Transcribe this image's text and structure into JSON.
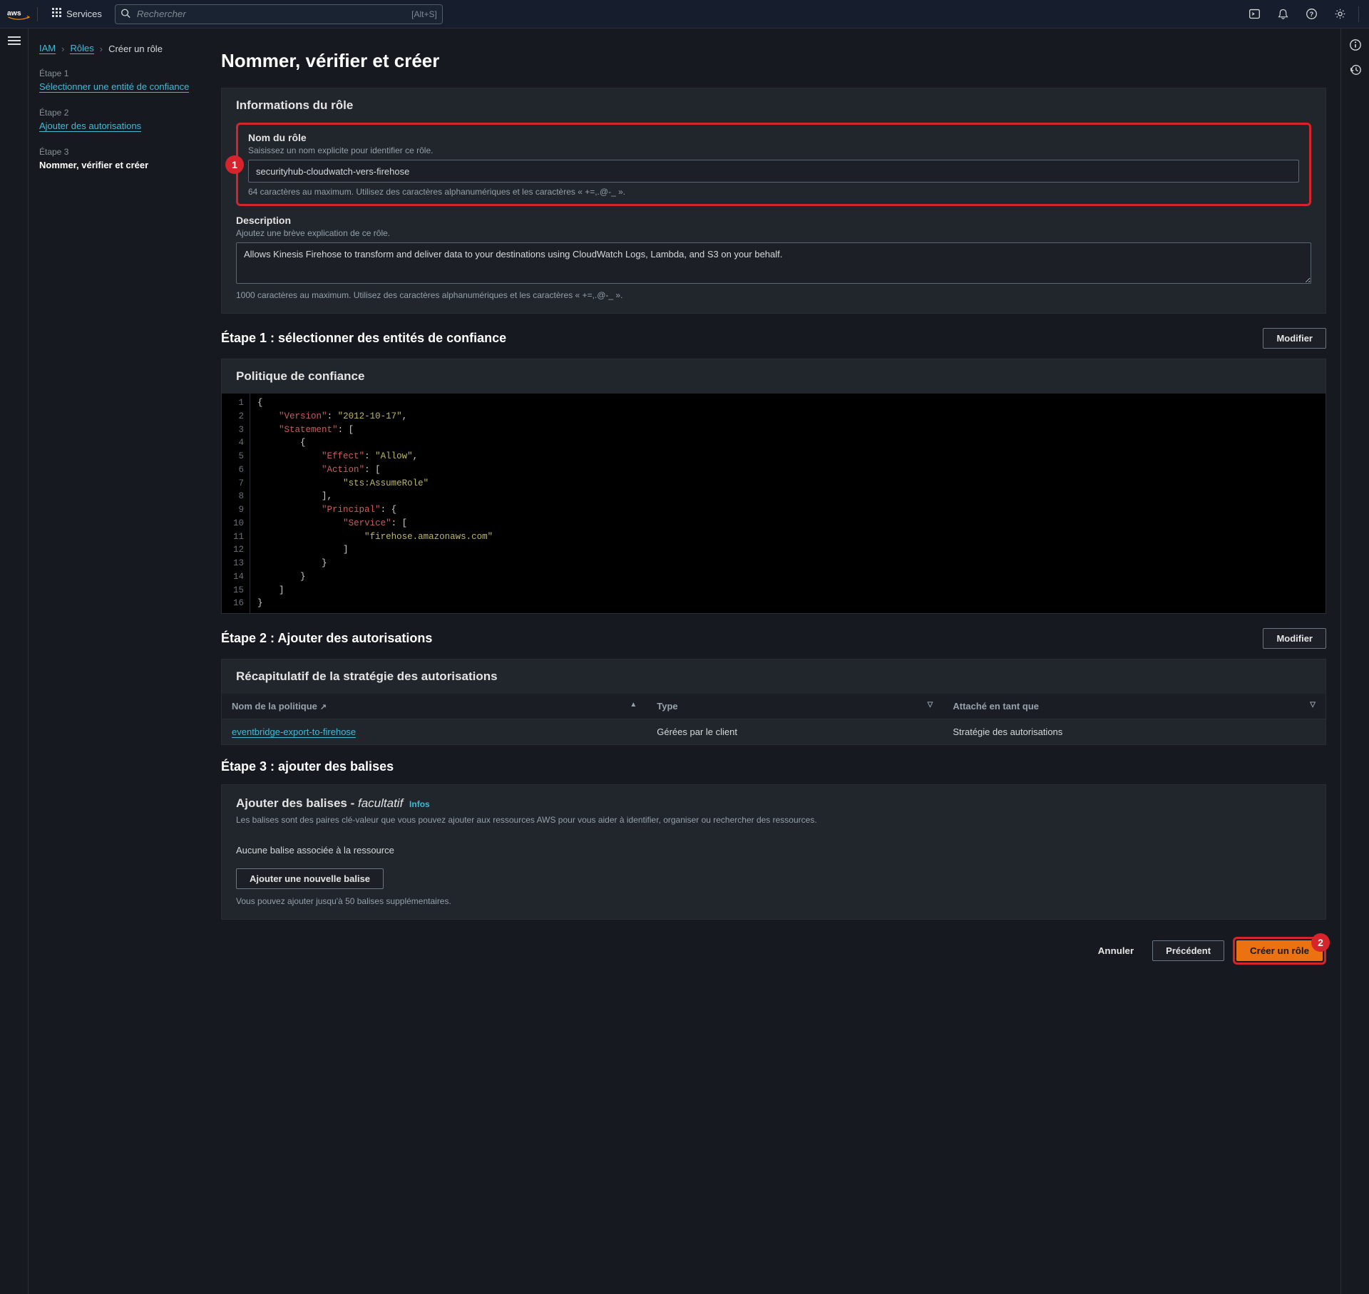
{
  "header": {
    "services_label": "Services",
    "search_placeholder": "Rechercher",
    "search_shortcut": "[Alt+S]"
  },
  "breadcrumbs": {
    "iam": "IAM",
    "roles": "Rôles",
    "current": "Créer un rôle"
  },
  "wizard": {
    "step1_label": "Étape 1",
    "step1_title": "Sélectionner une entité de confiance",
    "step2_label": "Étape 2",
    "step2_title": "Ajouter des autorisations",
    "step3_label": "Étape 3",
    "step3_title": "Nommer, vérifier et créer"
  },
  "page_title": "Nommer, vérifier et créer",
  "role_info": {
    "panel_title": "Informations du rôle",
    "name_label": "Nom du rôle",
    "name_hint": "Saisissez un nom explicite pour identifier ce rôle.",
    "name_value": "securityhub-cloudwatch-vers-firehose",
    "name_constraint": "64 caractères au maximum. Utilisez des caractères alphanumériques et les caractères « +=,.@-_ ».",
    "desc_label": "Description",
    "desc_hint": "Ajoutez une brève explication de ce rôle.",
    "desc_value": "Allows Kinesis Firehose to transform and deliver data to your destinations using CloudWatch Logs, Lambda, and S3 on your behalf.",
    "desc_constraint": "1000 caractères au maximum. Utilisez des caractères alphanumériques et les caractères « +=,.@-_ »."
  },
  "step1": {
    "section_title": "Étape 1 : sélectionner des entités de confiance",
    "edit_btn": "Modifier",
    "policy_title": "Politique de confiance",
    "code": {
      "version_key": "Version",
      "version_val": "2012-10-17",
      "statement_key": "Statement",
      "effect_key": "Effect",
      "effect_val": "Allow",
      "action_key": "Action",
      "action_val": "sts:AssumeRole",
      "principal_key": "Principal",
      "service_key": "Service",
      "service_val": "firehose.amazonaws.com"
    }
  },
  "step2": {
    "section_title": "Étape 2 : Ajouter des autorisations",
    "edit_btn": "Modifier",
    "summary_title": "Récapitulatif de la stratégie des autorisations",
    "th_name": "Nom de la politique",
    "th_type": "Type",
    "th_attached": "Attaché en tant que",
    "row_name": "eventbridge-export-to-firehose",
    "row_type": "Gérées par le client",
    "row_attached": "Stratégie des autorisations"
  },
  "step3": {
    "section_title": "Étape 3 : ajouter des balises",
    "tags_title_prefix": "Ajouter des balises - ",
    "tags_title_facultatif": "facultatif",
    "info": "Infos",
    "tags_desc": "Les balises sont des paires clé-valeur que vous pouvez ajouter aux ressources AWS pour vous aider à identifier, organiser ou rechercher des ressources.",
    "none_text": "Aucune balise associée à la ressource",
    "add_btn": "Ajouter une nouvelle balise",
    "limit_note": "Vous pouvez ajouter jusqu'à 50 balises supplémentaires."
  },
  "footer": {
    "cancel": "Annuler",
    "previous": "Précédent",
    "create": "Créer un rôle"
  },
  "annotations": {
    "badge1": "1",
    "badge2": "2"
  }
}
